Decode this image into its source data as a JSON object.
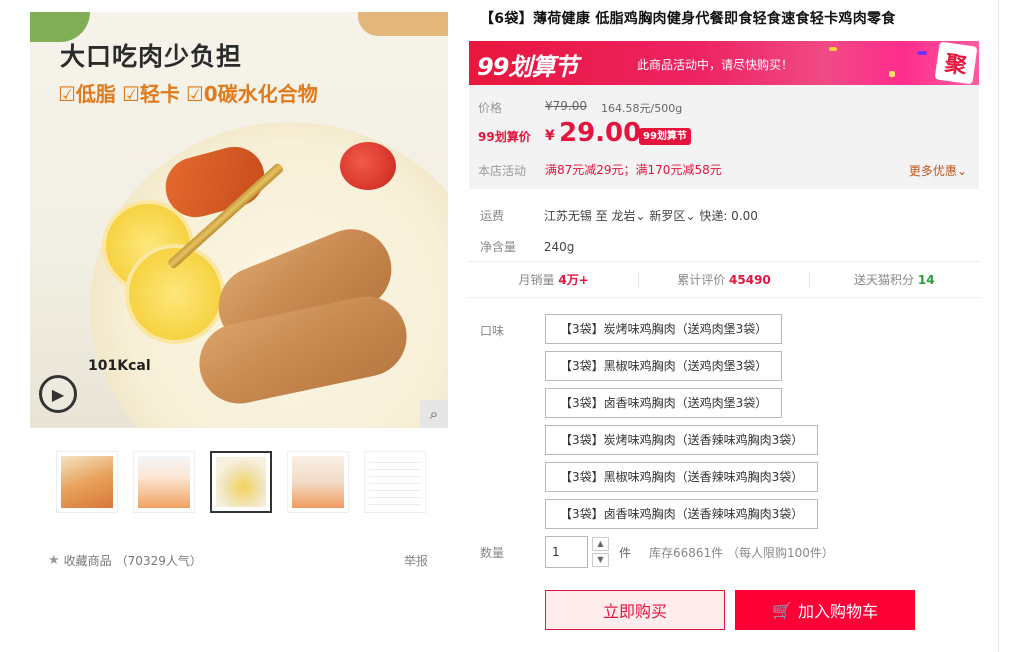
{
  "gallery": {
    "hero_title": "大口吃肉少负担",
    "hero_tags": [
      "☑低脂",
      "☑轻卡",
      "☑0碳水化合物"
    ],
    "kcal": "101Kcal",
    "thumbnails": [
      "thumb-1",
      "thumb-2",
      "thumb-3",
      "thumb-4",
      "thumb-5"
    ],
    "active_thumb_index": 2
  },
  "favorites": {
    "label": "收藏商品",
    "count": "（70329人气）",
    "report_label": "举报"
  },
  "product": {
    "title": "【6袋】薄荷健康 低脂鸡胸肉健身代餐即食轻食速食轻卡鸡肉零食"
  },
  "banner": {
    "logo": "99划算节",
    "message": "此商品活动中，请尽快购买！",
    "badge": "聚"
  },
  "price": {
    "label": "价格",
    "original": "¥79.00",
    "unit_price": "164.58元/500g",
    "promo_label": "99划算价",
    "currency": "¥",
    "current": "29.00",
    "tag": "99划算节",
    "activity_label": "本店活动",
    "activity": "满87元减29元；满170元减58元",
    "more": "更多优惠"
  },
  "shipping": {
    "label": "运费",
    "from": "江苏无锡",
    "to_word": "至",
    "to_city": "龙岩",
    "to_district": "新罗区",
    "fee": "快递: 0.00"
  },
  "net": {
    "label": "净含量",
    "value": "240g"
  },
  "stats": {
    "monthly_label": "月销量",
    "monthly_value": "4万+",
    "reviews_label": "累计评价",
    "reviews_value": "45490",
    "points_label": "送天猫积分",
    "points_value": "14"
  },
  "flavor": {
    "label": "口味",
    "options": [
      "【3袋】炭烤味鸡胸肉（送鸡肉堡3袋）",
      "【3袋】黑椒味鸡胸肉（送鸡肉堡3袋）",
      "【3袋】卤香味鸡胸肉（送鸡肉堡3袋）",
      "【3袋】炭烤味鸡胸肉（送香辣味鸡胸肉3袋）",
      "【3袋】黑椒味鸡胸肉（送香辣味鸡胸肉3袋）",
      "【3袋】卤香味鸡胸肉（送香辣味鸡胸肉3袋）"
    ]
  },
  "quantity": {
    "label": "数量",
    "value": "1",
    "unit": "件",
    "stock": "库存66861件 （每人限购100件）"
  },
  "actions": {
    "buy_now": "立即购买",
    "add_to_cart": "加入购物车"
  },
  "colors": {
    "accent": "#e4143c",
    "cart": "#ff0036",
    "promo_orange": "#c2571a",
    "tag_orange": "#e07a1a"
  }
}
